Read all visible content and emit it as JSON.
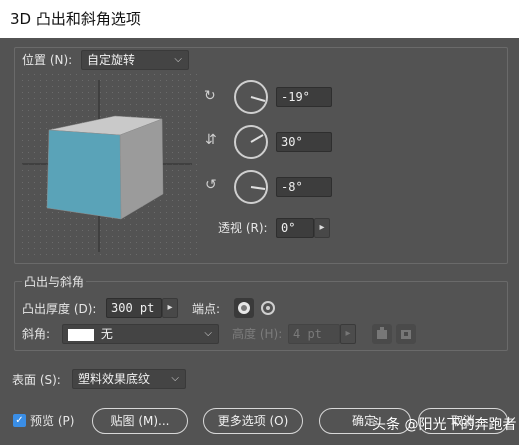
{
  "window": {
    "title": "3D 凸出和斜角选项"
  },
  "position": {
    "label": "位置 (N):",
    "preset": "自定旋转",
    "x_rotation": "-19°",
    "y_rotation": "30°",
    "z_rotation": "-8°",
    "perspective_label": "透视 (R):",
    "perspective_value": "0°"
  },
  "extrude": {
    "section_label": "凸出与斜角",
    "depth_label": "凸出厚度 (D):",
    "depth_value": "300 pt",
    "cap_label": "端点:",
    "bevel_label": "斜角:",
    "bevel_value": "无",
    "height_label": "高度 (H):",
    "height_value": "4 pt"
  },
  "surface": {
    "label": "表面 (S):",
    "value": "塑料效果底纹"
  },
  "footer": {
    "preview_label": "预览 (P)",
    "preview_checked": true,
    "map_button": "贴图 (M)...",
    "more_button": "更多选项 (O)",
    "ok_button": "确定",
    "cancel_button": "取消"
  },
  "watermark": "头条 @阳光下的奔跑者",
  "colors": {
    "cube_front": "#5aa3b8",
    "cube_top": "#c8c8c8",
    "cube_side": "#9a9a9a",
    "accent": "#3a8ee6"
  }
}
